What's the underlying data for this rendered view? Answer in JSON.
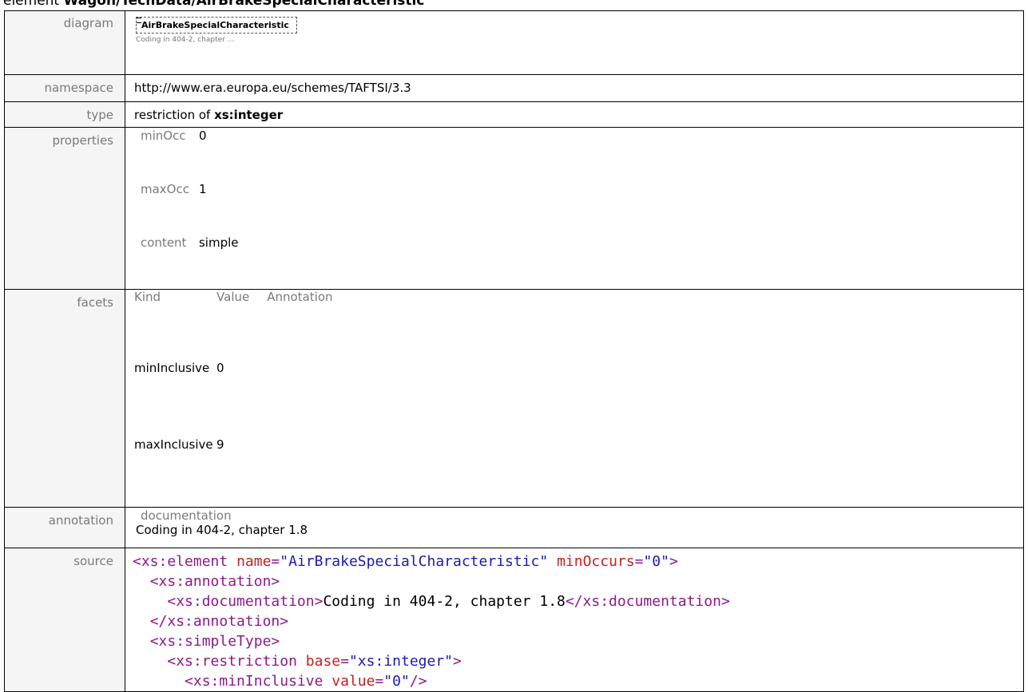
{
  "heading": {
    "prefix": "element ",
    "name": "Wagon/TechData/AirBrakeSpecialCharacteristic"
  },
  "rows": {
    "diagram": {
      "label": "diagram",
      "box_text": "AirBrakeSpecialCharacteristic",
      "note": "Coding in 404-2, chapter ..."
    },
    "namespace": {
      "label": "namespace",
      "value": "http://www.era.europa.eu/schemes/TAFTSI/3.3"
    },
    "type": {
      "label": "type",
      "prefix": "restriction of ",
      "base": "xs:integer"
    },
    "properties": {
      "label": "properties",
      "items": [
        {
          "key": "minOcc",
          "value": "0"
        },
        {
          "key": "maxOcc",
          "value": "1"
        },
        {
          "key": "content",
          "value": "simple"
        }
      ]
    },
    "facets": {
      "label": "facets",
      "headers": [
        "Kind",
        "Value",
        "Annotation"
      ],
      "items": [
        {
          "kind": "minInclusive",
          "value": "0"
        },
        {
          "kind": "maxInclusive",
          "value": "9"
        }
      ]
    },
    "annotation": {
      "label": "annotation",
      "key": "documentation",
      "value": "Coding in 404-2, chapter 1.8"
    },
    "source": {
      "label": "source",
      "lines": [
        {
          "indent": "",
          "tag": "<xs:element",
          "attrs": [
            {
              "name": "name",
              "value": "\"AirBrakeSpecialCharacteristic\""
            },
            {
              "name": "minOccurs",
              "value": "\"0\""
            }
          ],
          "close": ">",
          "text": "",
          "end": ""
        },
        {
          "indent": "  ",
          "tag": "<xs:annotation",
          "attrs": [],
          "close": ">",
          "text": "",
          "end": ""
        },
        {
          "indent": "    ",
          "tag": "<xs:documentation",
          "attrs": [],
          "close": ">",
          "text": "Coding in 404-2, chapter 1.8",
          "end": "</xs:documentation>"
        },
        {
          "indent": "  ",
          "tag": "</xs:annotation",
          "attrs": [],
          "close": ">",
          "text": "",
          "end": ""
        },
        {
          "indent": "  ",
          "tag": "<xs:simpleType",
          "attrs": [],
          "close": ">",
          "text": "",
          "end": ""
        },
        {
          "indent": "    ",
          "tag": "<xs:restriction",
          "attrs": [
            {
              "name": "base",
              "value": "\"xs:integer\""
            }
          ],
          "close": ">",
          "text": "",
          "end": ""
        },
        {
          "indent": "      ",
          "tag": "<xs:minInclusive",
          "attrs": [
            {
              "name": "value",
              "value": "\"0\""
            }
          ],
          "close": "/>",
          "text": "",
          "end": ""
        }
      ]
    }
  }
}
